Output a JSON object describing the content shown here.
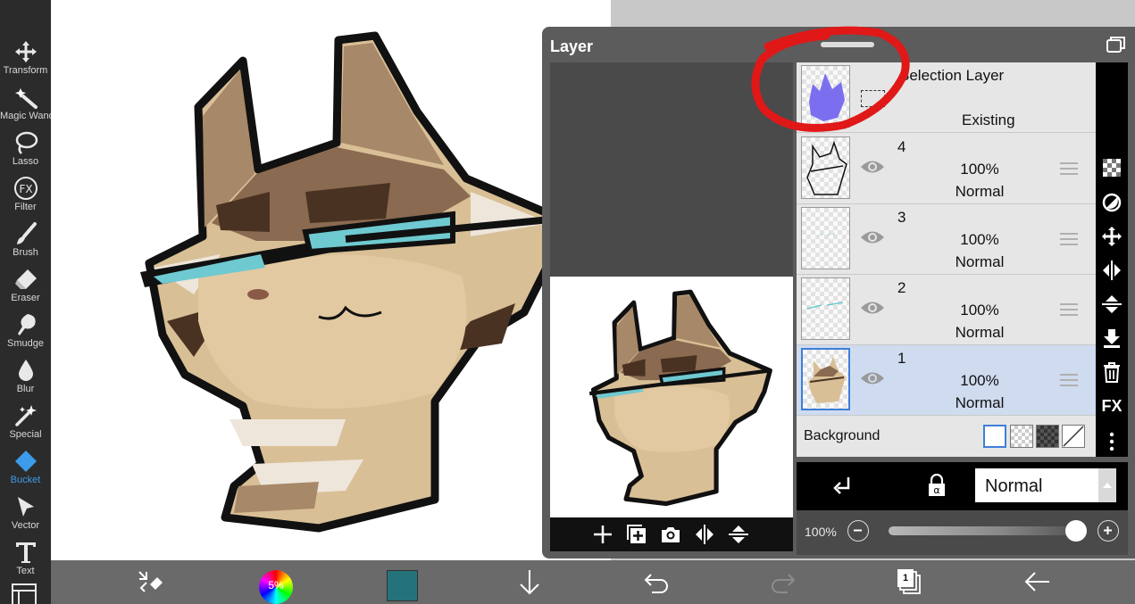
{
  "tools": [
    {
      "label": "Transform",
      "icon": "move-arrows-icon"
    },
    {
      "label": "Magic Wand",
      "icon": "magic-wand-icon"
    },
    {
      "label": "Lasso",
      "icon": "lasso-icon"
    },
    {
      "label": "Filter",
      "icon": "fx-filter-icon"
    },
    {
      "label": "Brush",
      "icon": "brush-icon"
    },
    {
      "label": "Eraser",
      "icon": "eraser-icon"
    },
    {
      "label": "Smudge",
      "icon": "smudge-icon"
    },
    {
      "label": "Blur",
      "icon": "blur-drop-icon"
    },
    {
      "label": "Special",
      "icon": "special-sparkle-icon"
    },
    {
      "label": "Bucket",
      "icon": "bucket-icon",
      "active": true
    },
    {
      "label": "Vector",
      "icon": "vector-cursor-icon"
    },
    {
      "label": "Text",
      "icon": "text-icon"
    }
  ],
  "layer_panel": {
    "title": "Layer",
    "selection_layer": {
      "name": "Selection Layer",
      "status": "Existing"
    },
    "layers": [
      {
        "name": "4",
        "opacity": "100%",
        "blend": "Normal",
        "selected": false
      },
      {
        "name": "3",
        "opacity": "100%",
        "blend": "Normal",
        "selected": false
      },
      {
        "name": "2",
        "opacity": "100%",
        "blend": "Normal",
        "selected": false
      },
      {
        "name": "1",
        "opacity": "100%",
        "blend": "Normal",
        "selected": true
      }
    ],
    "background": {
      "label": "Background"
    },
    "filter_label": "FX",
    "blend_mode": "Normal",
    "opacity_label": "100%",
    "opacity_value": 1.0
  },
  "bottom": {
    "color_percent": "5%",
    "current_color": "#25737a",
    "page_number": "1"
  },
  "colors": {
    "accent": "#3d9be9",
    "annotation": "#e01818",
    "selection_fill": "#7b6ff0",
    "fur_light": "#d9bf96",
    "fur_mid": "#a78868",
    "fur_dark": "#4a3222",
    "eyes": "#6fc9d0"
  }
}
